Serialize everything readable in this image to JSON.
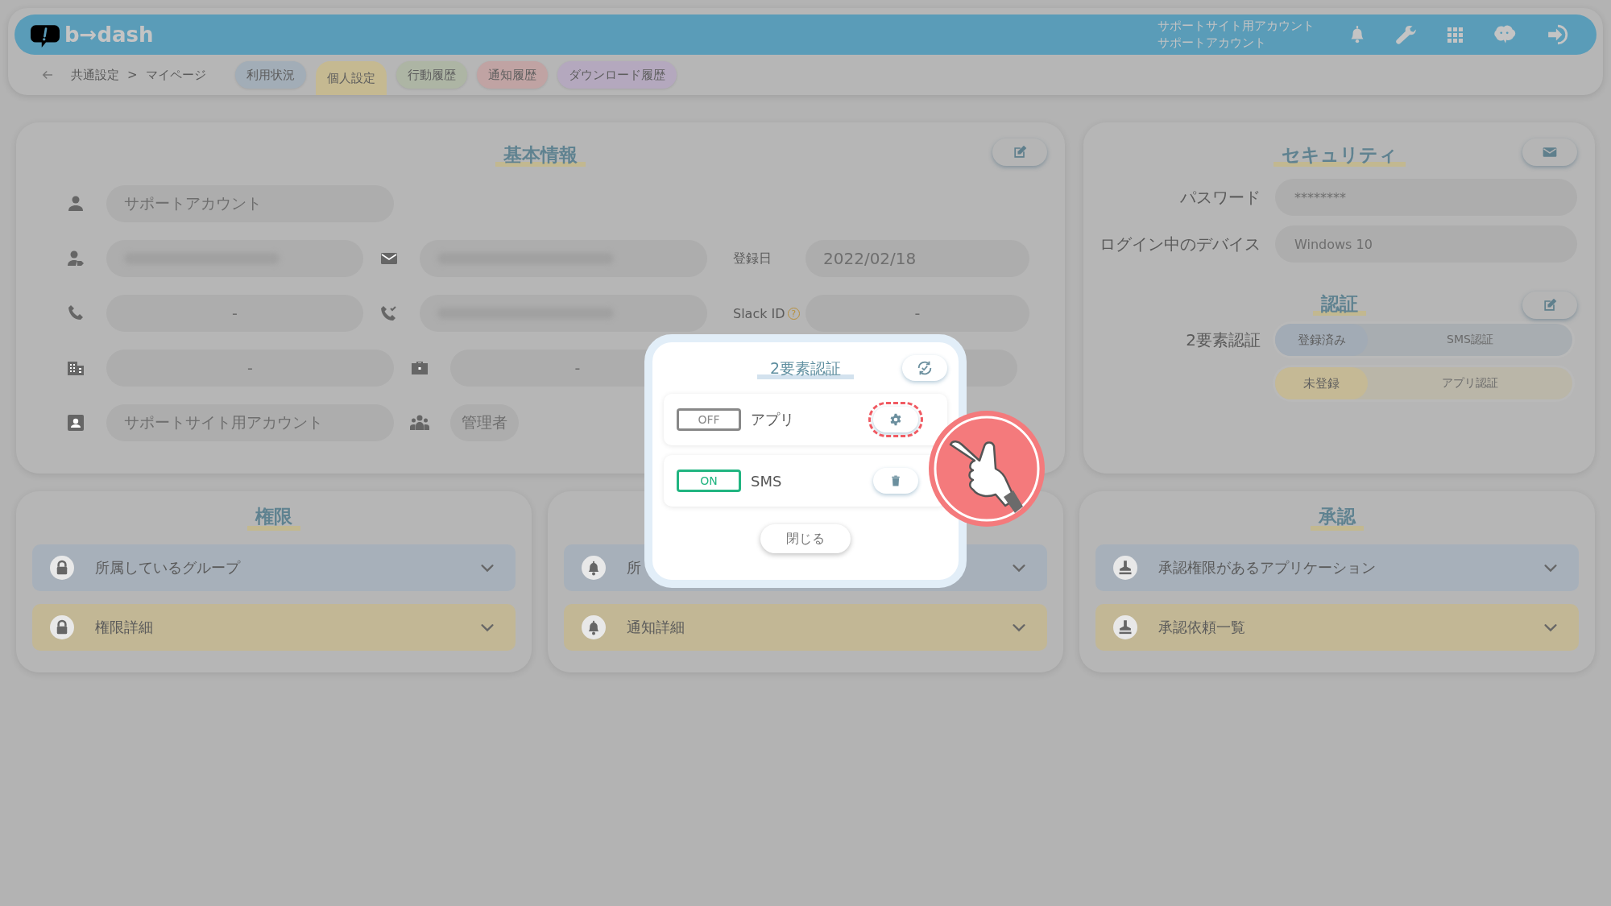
{
  "header": {
    "logo": "b→dash",
    "account": [
      "サポートサイト用アカウント",
      "サポートアカウント"
    ]
  },
  "nav": {
    "breadcrumb": [
      "共通設定",
      ">",
      "マイページ"
    ],
    "tabs": [
      {
        "label": "利用状況",
        "selected": false,
        "color": "#a2adb7"
      },
      {
        "label": "個人設定",
        "selected": true,
        "color": "#c5b991"
      },
      {
        "label": "行動履歴",
        "selected": false,
        "color": "#adb5a4"
      },
      {
        "label": "通知履歴",
        "selected": false,
        "color": "#c0a3a3"
      },
      {
        "label": "ダウンロード履歴",
        "selected": false,
        "color": "#b4a8be"
      }
    ]
  },
  "basic_info": {
    "title": "基本情報",
    "rows": [
      [
        {
          "kind": "text",
          "value": "サポートアカウント"
        }
      ],
      [
        {
          "kind": "blurred"
        },
        {
          "kind": "blurred"
        },
        {
          "kind": "text",
          "label": "登録日",
          "value": "2022/02/18"
        }
      ],
      [
        {
          "kind": "text",
          "value": "-"
        },
        {
          "kind": "blurred"
        },
        {
          "kind": "text",
          "label": "Slack ID",
          "help": "?",
          "value": "-"
        }
      ],
      [
        {
          "kind": "text",
          "value": "-"
        },
        {
          "kind": "text",
          "value": "-"
        },
        {
          "kind": "empty"
        }
      ],
      [
        {
          "kind": "text",
          "value": "サポートサイト用アカウント"
        },
        {
          "kind": "text",
          "value": "管理者"
        }
      ]
    ]
  },
  "security": {
    "title": "セキュリティ",
    "fields": [
      {
        "label": "パスワード",
        "value": "********"
      },
      {
        "label": "ログイン中のデバイス",
        "value": "Windows 10"
      }
    ],
    "auth": {
      "title": "認証",
      "label": "2要素認証",
      "methods": [
        {
          "status": "登録済み",
          "name": "SMS認証",
          "registered": true
        },
        {
          "status": "未登録",
          "name": "アプリ認証",
          "registered": false
        }
      ]
    }
  },
  "panels": [
    {
      "title": "権限",
      "items": [
        {
          "label": "所属しているグループ"
        },
        {
          "label": "権限詳細"
        }
      ]
    },
    {
      "items": [
        {
          "label": "所"
        },
        {
          "label": "通知詳細"
        }
      ]
    },
    {
      "title": "承認",
      "items": [
        {
          "label": "承認権限があるアプリケーション"
        },
        {
          "label": "承認依頼一覧"
        }
      ]
    }
  ],
  "modal": {
    "title": "2要素認証",
    "methods": [
      {
        "state": "OFF",
        "on": false,
        "name": "アプリ",
        "kind": "settings",
        "highlighted": true
      },
      {
        "state": "ON",
        "on": true,
        "name": "SMS",
        "kind": "delete",
        "highlighted": false
      }
    ],
    "close": "閉じる"
  }
}
